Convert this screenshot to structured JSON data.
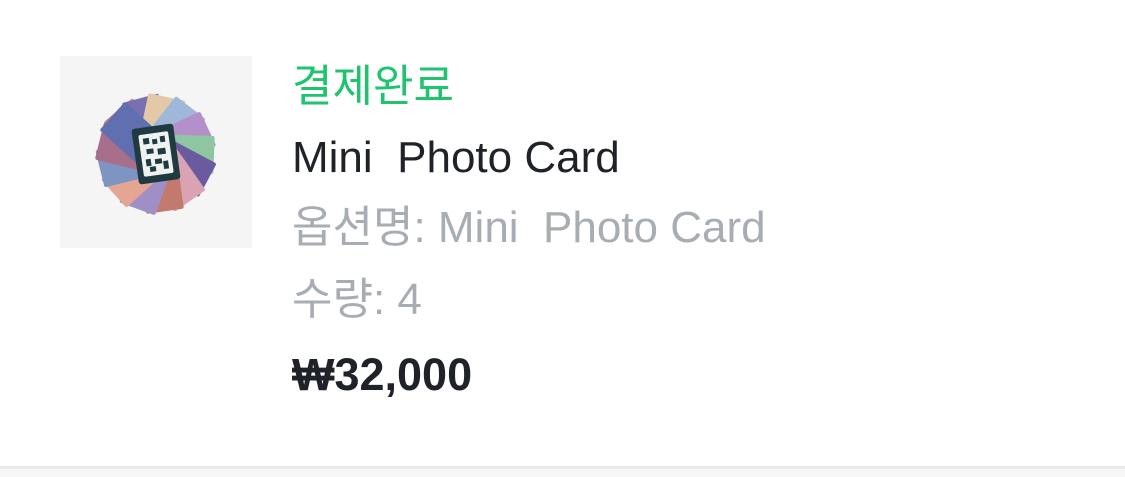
{
  "order": {
    "status": "결제완료",
    "product_name": "Mini  Photo Card",
    "option_text": "옵션명: Mini  Photo Card",
    "quantity_text": "수량: 4",
    "price": "₩32,000"
  },
  "colors": {
    "status_green": "#1ec46e",
    "text_dark": "#1f2329",
    "text_muted": "#a8adb4",
    "thumb_bg": "#f5f5f5"
  },
  "icons": {
    "product_image": "photo-card-fan-image"
  }
}
